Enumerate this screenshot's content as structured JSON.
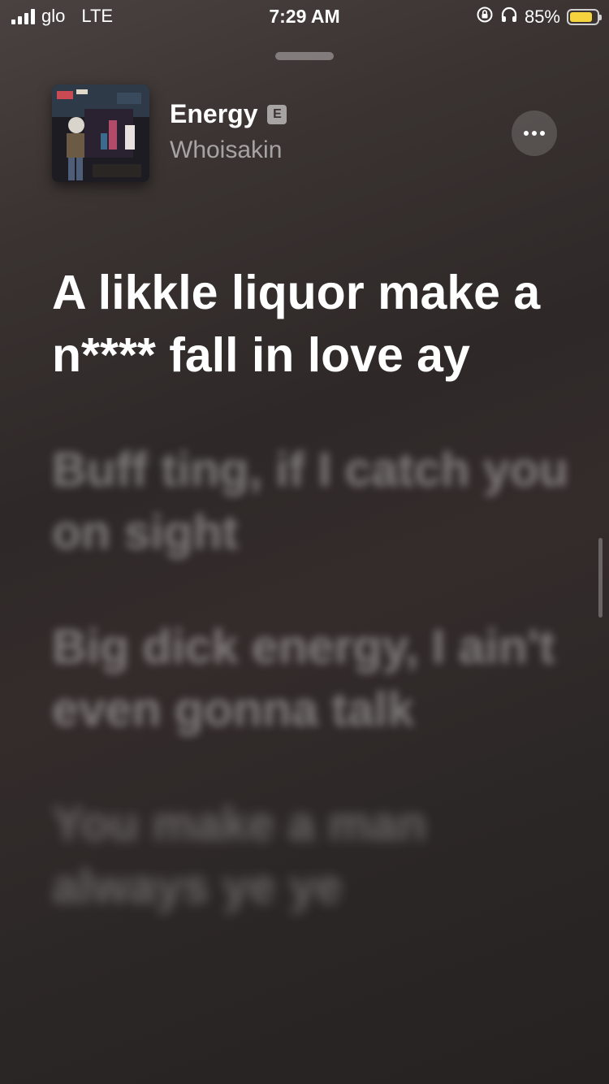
{
  "status": {
    "carrier": "glo",
    "network": "LTE",
    "time": "7:29 AM",
    "battery_percent_text": "85%",
    "battery_level": 0.85
  },
  "track": {
    "title": "Energy",
    "explicit_badge": "E",
    "artist": "Whoisakin"
  },
  "lyrics": {
    "current": "A likkle liquor make a n**** fall in love ay",
    "upcoming": [
      "Buff ting, if I catch you on sight",
      "Big dick energy, I ain't even gonna talk",
      "You make a man always ye ye"
    ]
  },
  "icons": {
    "signal": "signal-bars-icon",
    "rotation_lock": "rotation-lock-icon",
    "headphones": "headphones-icon",
    "battery": "battery-icon",
    "more": "more-icon"
  },
  "colors": {
    "battery_fill": "#f5d33e",
    "background_top": "#4a4240",
    "background_bottom": "#262222"
  }
}
